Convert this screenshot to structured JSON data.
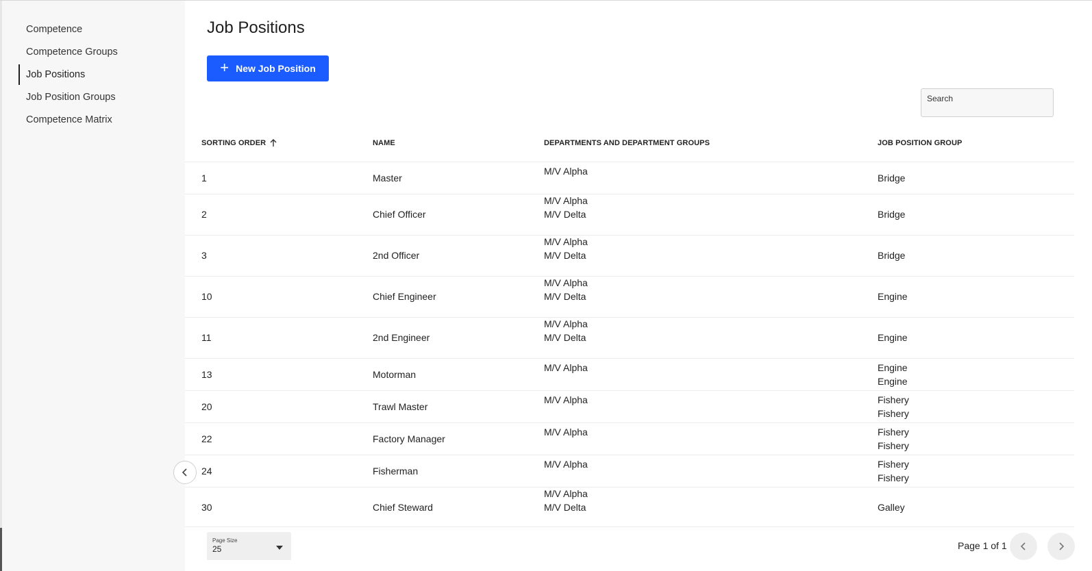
{
  "sidebar": {
    "items": [
      {
        "label": "Competence"
      },
      {
        "label": "Competence Groups"
      },
      {
        "label": "Job Positions"
      },
      {
        "label": "Job Position Groups"
      },
      {
        "label": "Competence Matrix"
      }
    ],
    "active_item": "Job Positions"
  },
  "header": {
    "title": "Job Positions",
    "new_button_label": "New Job Position"
  },
  "search": {
    "placeholder": "Search"
  },
  "table": {
    "columns": [
      "SORTING ORDER",
      "NAME",
      "DEPARTMENTS AND DEPARTMENT GROUPS",
      "JOB POSITION GROUP"
    ],
    "sort_column": "SORTING ORDER",
    "sort_direction": "ascending",
    "rows": [
      {
        "order": "1",
        "name": "Master",
        "departments": [
          "M/V Alpha"
        ],
        "groups": [
          "Bridge"
        ]
      },
      {
        "order": "2",
        "name": "Chief Officer",
        "departments": [
          "M/V Alpha",
          "M/V Delta"
        ],
        "groups": [
          "Bridge"
        ]
      },
      {
        "order": "3",
        "name": "2nd Officer",
        "departments": [
          "M/V Alpha",
          "M/V Delta"
        ],
        "groups": [
          "Bridge"
        ]
      },
      {
        "order": "10",
        "name": "Chief Engineer",
        "departments": [
          "M/V Alpha",
          "M/V Delta"
        ],
        "groups": [
          "Engine"
        ]
      },
      {
        "order": "11",
        "name": "2nd Engineer",
        "departments": [
          "M/V Alpha",
          "M/V Delta"
        ],
        "groups": [
          "Engine"
        ]
      },
      {
        "order": "13",
        "name": "Motorman",
        "departments": [
          "M/V Alpha"
        ],
        "groups": [
          "Engine",
          "Engine"
        ]
      },
      {
        "order": "20",
        "name": "Trawl Master",
        "departments": [
          "M/V Alpha"
        ],
        "groups": [
          "Fishery",
          "Fishery"
        ]
      },
      {
        "order": "22",
        "name": "Factory Manager",
        "departments": [
          "M/V Alpha"
        ],
        "groups": [
          "Fishery",
          "Fishery"
        ]
      },
      {
        "order": "24",
        "name": "Fisherman",
        "departments": [
          "M/V Alpha"
        ],
        "groups": [
          "Fishery",
          "Fishery"
        ]
      },
      {
        "order": "30",
        "name": "Chief Steward",
        "departments": [
          "M/V Alpha",
          "M/V Delta"
        ],
        "groups": [
          "Galley"
        ]
      }
    ]
  },
  "footer": {
    "page_size_label": "Page Size",
    "page_size_value": "25",
    "page_info": "Page 1 of 1"
  },
  "colors": {
    "accent": "#1a5cff",
    "sidebar_bg": "#f7f7f7"
  },
  "icons": {
    "sort": "arrow-up-icon",
    "collapse": "chevron-left-icon",
    "prev": "chevron-left-icon",
    "next": "chevron-right-icon",
    "add": "plus-icon",
    "dropdown": "caret-down-icon"
  }
}
